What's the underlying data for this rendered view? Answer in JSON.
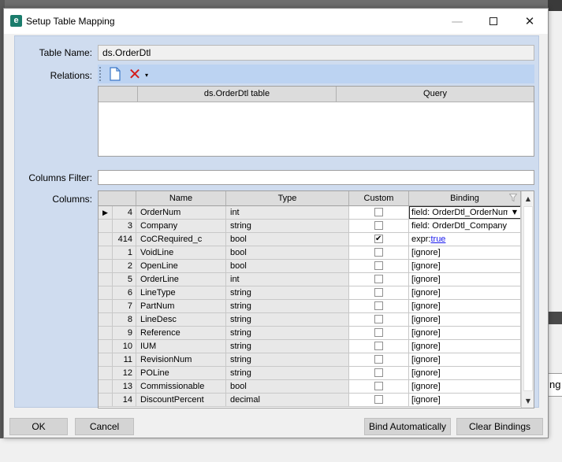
{
  "window": {
    "title": "Setup Table Mapping",
    "app_icon_letter": "e",
    "minimize_glyph": "—",
    "close_glyph": "✕"
  },
  "background": {
    "right_button_fragment": "ng"
  },
  "form": {
    "table_name_label": "Table Name:",
    "table_name_value": "ds.OrderDtl",
    "relations_label": "Relations:",
    "columns_filter_label": "Columns Filter:",
    "columns_filter_value": "",
    "columns_label": "Columns:"
  },
  "relations": {
    "toolbar": {
      "delete_glyph": "✕",
      "dropdown_glyph": "▾"
    },
    "headers": [
      "",
      "ds.OrderDtl table",
      "Query"
    ]
  },
  "columns_grid": {
    "headers": {
      "name": "Name",
      "type": "Type",
      "custom": "Custom",
      "binding": "Binding"
    },
    "current_row_glyph": "▶",
    "binding_dropdown_glyph": "▼",
    "rows": [
      {
        "num": "4",
        "name": "OrderNum",
        "type": "int",
        "custom": false,
        "binding": "field: OrderDtl_OrderNum",
        "current": true
      },
      {
        "num": "3",
        "name": "Company",
        "type": "string",
        "custom": false,
        "binding": "field: OrderDtl_Company"
      },
      {
        "num": "414",
        "name": "CoCRequired_c",
        "type": "bool",
        "custom": true,
        "binding_prefix": "expr:",
        "binding_link": "true"
      },
      {
        "num": "1",
        "name": "VoidLine",
        "type": "bool",
        "custom": false,
        "binding": "[ignore]"
      },
      {
        "num": "2",
        "name": "OpenLine",
        "type": "bool",
        "custom": false,
        "binding": "[ignore]"
      },
      {
        "num": "5",
        "name": "OrderLine",
        "type": "int",
        "custom": false,
        "binding": "[ignore]"
      },
      {
        "num": "6",
        "name": "LineType",
        "type": "string",
        "custom": false,
        "binding": "[ignore]"
      },
      {
        "num": "7",
        "name": "PartNum",
        "type": "string",
        "custom": false,
        "binding": "[ignore]"
      },
      {
        "num": "8",
        "name": "LineDesc",
        "type": "string",
        "custom": false,
        "binding": "[ignore]"
      },
      {
        "num": "9",
        "name": "Reference",
        "type": "string",
        "custom": false,
        "binding": "[ignore]"
      },
      {
        "num": "10",
        "name": "IUM",
        "type": "string",
        "custom": false,
        "binding": "[ignore]"
      },
      {
        "num": "11",
        "name": "RevisionNum",
        "type": "string",
        "custom": false,
        "binding": "[ignore]"
      },
      {
        "num": "12",
        "name": "POLine",
        "type": "string",
        "custom": false,
        "binding": "[ignore]"
      },
      {
        "num": "13",
        "name": "Commissionable",
        "type": "bool",
        "custom": false,
        "binding": "[ignore]"
      },
      {
        "num": "14",
        "name": "DiscountPercent",
        "type": "decimal",
        "custom": false,
        "binding": "[ignore]"
      }
    ],
    "scroll_up_glyph": "▲",
    "scroll_down_glyph": "▼"
  },
  "buttons": {
    "ok": "OK",
    "cancel": "Cancel",
    "bind_automatically": "Bind Automatically",
    "clear_bindings": "Clear Bindings"
  },
  "colors": {
    "panel_background": "#cfdcef",
    "toolbar_background": "#bcd3f2",
    "delete_red": "#d41c1c",
    "link_blue": "#1a1aee",
    "app_icon": "#1a7c6c"
  }
}
